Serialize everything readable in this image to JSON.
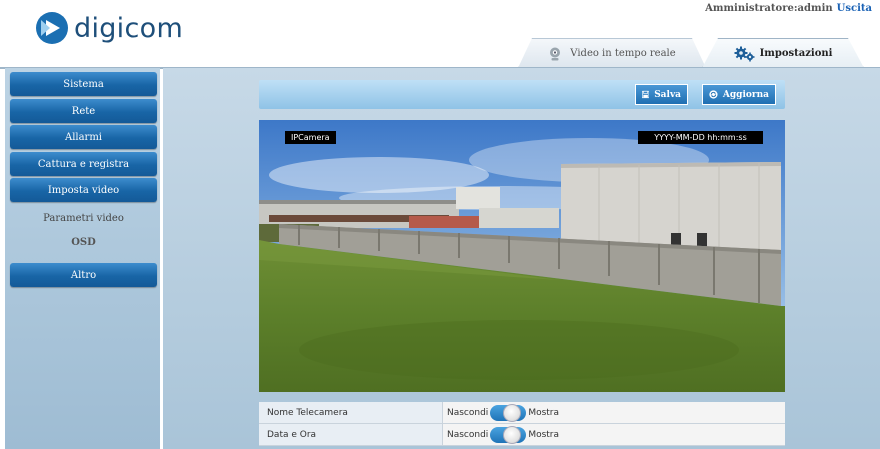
{
  "header": {
    "brand": "digicom",
    "user_label": "Amministratore:admin",
    "logout_label": "Uscita",
    "tabs": [
      {
        "label": "Video in tempo reale",
        "icon": "webcam-icon",
        "active": false
      },
      {
        "label": "Impostazioni",
        "icon": "gears-icon",
        "active": true
      }
    ]
  },
  "sidebar": {
    "items": [
      {
        "label": "Sistema"
      },
      {
        "label": "Rete"
      },
      {
        "label": "Allarmi"
      },
      {
        "label": "Cattura e registra"
      },
      {
        "label": "Imposta video"
      }
    ],
    "subitems": [
      {
        "label": "Parametri video",
        "active": false
      },
      {
        "label": "OSD",
        "active": true
      }
    ],
    "extra": {
      "label": "Altro"
    }
  },
  "toolbar": {
    "save_label": "Salva",
    "refresh_label": "Aggiorna"
  },
  "video": {
    "osd_name": "IPCamera",
    "osd_datetime": "YYYY-MM-DD hh:mm:ss"
  },
  "settings": {
    "rows": [
      {
        "label": "Nome Telecamera",
        "off_label": "Nascondi",
        "on_label": "Mostra"
      },
      {
        "label": "Data e Ora",
        "off_label": "Nascondi",
        "on_label": "Mostra"
      }
    ]
  },
  "colors": {
    "accent": "#1b6fb2",
    "nav_button": "#1865a6",
    "link": "#1a62b5"
  }
}
